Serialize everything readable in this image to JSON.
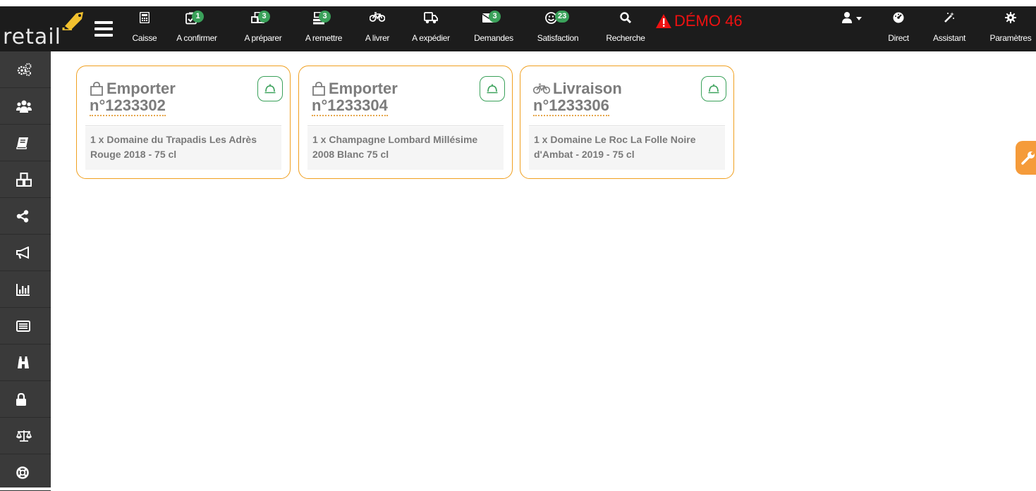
{
  "brand": {
    "logo_text": "retail"
  },
  "nav": {
    "items": [
      {
        "label": "Caisse",
        "icon": "calculator-icon"
      },
      {
        "label": "A confirmer",
        "icon": "checklist-icon",
        "badge": "1"
      },
      {
        "label": "A préparer",
        "icon": "boxes-icon",
        "badge": "3"
      },
      {
        "label": "A remettre",
        "icon": "register-icon",
        "badge": "3"
      },
      {
        "label": "A livrer",
        "icon": "bicycle-icon"
      },
      {
        "label": "A expédier",
        "icon": "truck-icon"
      },
      {
        "label": "Demandes",
        "icon": "envelope-icon",
        "badge": "3"
      },
      {
        "label": "Satisfaction",
        "icon": "smiley-icon",
        "badge": "23"
      },
      {
        "label": "Recherche",
        "icon": "search-icon"
      }
    ],
    "demo_label": "DÉMO 46",
    "right_items": [
      {
        "label": "Direct",
        "icon": "dashboard-icon"
      },
      {
        "label": "Assistant",
        "icon": "magic-wand-icon"
      },
      {
        "label": "Paramètres",
        "icon": "gear-icon"
      }
    ]
  },
  "sidebar": {
    "items": [
      "cogs-icon",
      "users-icon",
      "book-icon",
      "cubes-icon",
      "share-icon",
      "bullhorn-icon",
      "bar-chart-icon",
      "list-icon",
      "binoculars-icon",
      "lock-icon",
      "scale-icon",
      "lifebuoy-icon"
    ]
  },
  "orders": [
    {
      "type": "Emporter",
      "icon": "bag-icon",
      "number": "n°1233302",
      "line": "1 x Domaine du Trapadis Les Adrès Rouge 2018 - 75 cl"
    },
    {
      "type": "Emporter",
      "icon": "bag-icon",
      "number": "n°1233304",
      "line": "1 x Champagne Lombard Millésime 2008 Blanc 75 cl"
    },
    {
      "type": "Livraison",
      "icon": "bicycle-icon",
      "number": "n°1233306",
      "line": "1 x Domaine Le Roc La Folle Noire d'Ambat - 2019 - 75 cl"
    }
  ],
  "colors": {
    "navbar_bg": "#1c1c1c",
    "sidebar_bg": "#3a3a3a",
    "badge_green": "#3aa15a",
    "card_border": "#f0a020",
    "demo_red": "#ee1111",
    "float_orange": "#f59b3a"
  }
}
